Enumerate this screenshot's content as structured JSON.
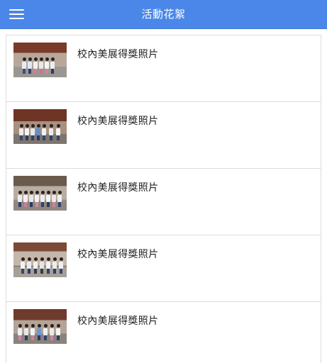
{
  "header": {
    "title": "活動花絮",
    "bg_color": "#4a87e8",
    "menu_icon": "hamburger-menu-icon"
  },
  "gallery": {
    "items": [
      {
        "label": "校內美展得獎照片"
      },
      {
        "label": "校內美展得獎照片"
      },
      {
        "label": "校內美展得獎照片"
      },
      {
        "label": "校內美展得獎照片"
      },
      {
        "label": "校內美展得獎照片"
      }
    ]
  }
}
